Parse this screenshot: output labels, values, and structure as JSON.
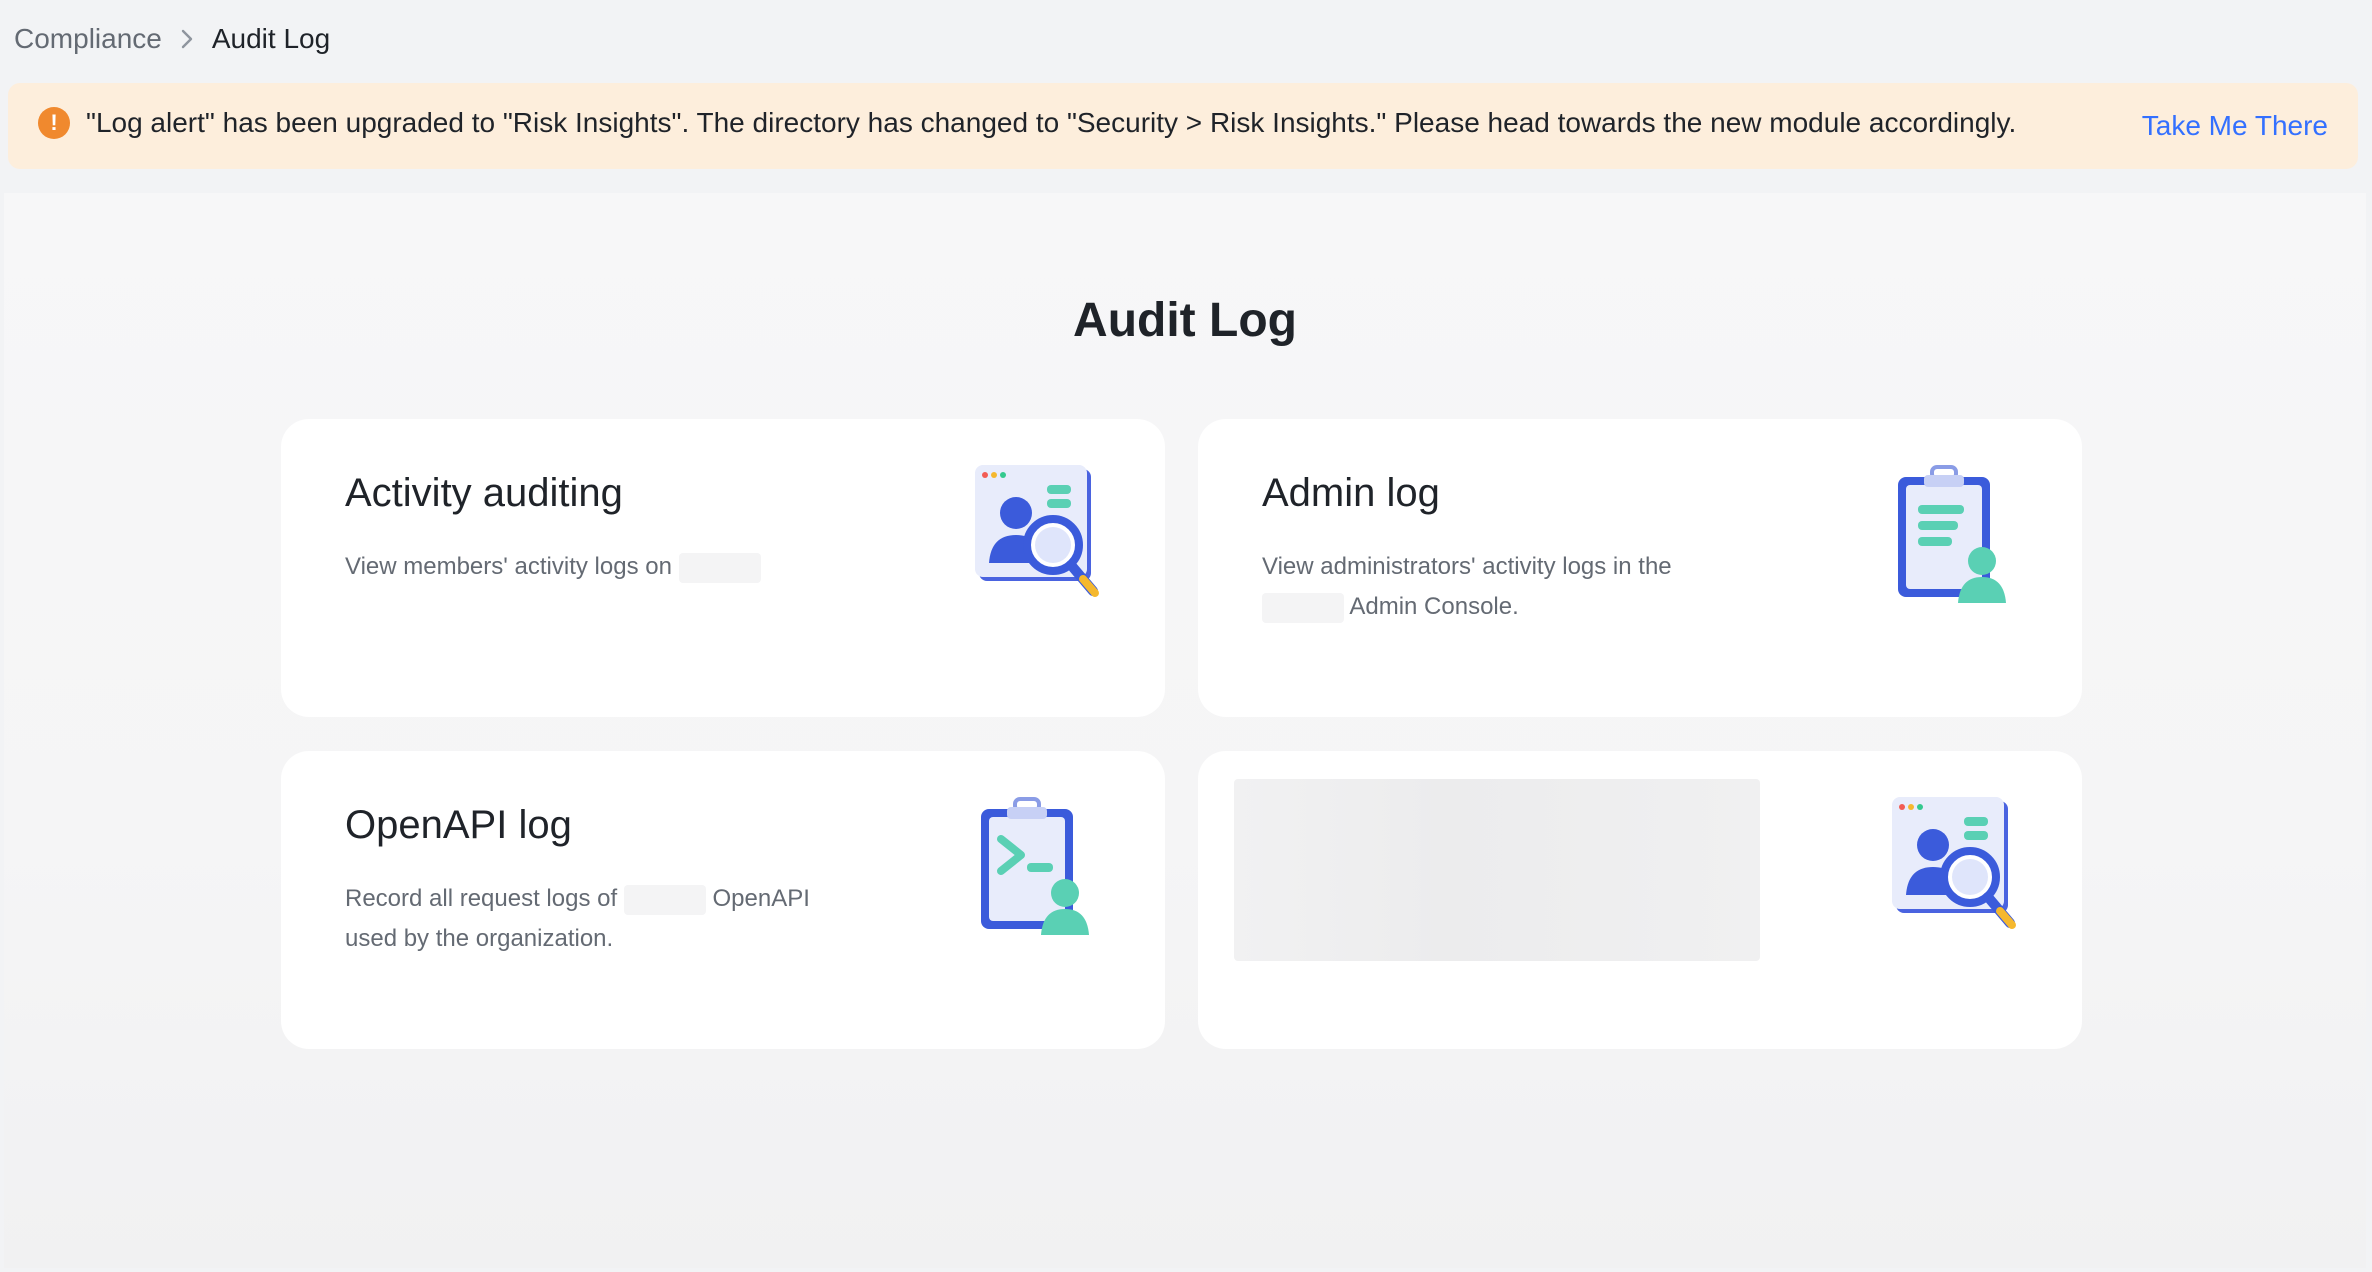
{
  "breadcrumb": {
    "parent": "Compliance",
    "current": "Audit Log"
  },
  "alert": {
    "message": "\"Log alert\" has been upgraded to \"Risk Insights\". The directory has changed to \"Security > Risk Insights.\" Please head towards the new module accordingly.",
    "link_label": "Take Me There",
    "accent_color": "#f0892e",
    "background_color": "#fdeedc",
    "link_color": "#3370ff"
  },
  "main": {
    "title": "Audit Log",
    "cards": [
      {
        "title": "Activity auditing",
        "desc_before": "View members' activity logs on",
        "desc_after": "",
        "icon": "profile-magnifier-icon"
      },
      {
        "title": "Admin log",
        "desc_before": "View administrators' activity logs in the",
        "desc_after": "Admin Console.",
        "icon": "clipboard-user-icon"
      },
      {
        "title": "OpenAPI log",
        "desc_before": "Record all request logs of",
        "desc_after": "OpenAPI used by the organization.",
        "icon": "clipboard-terminal-icon"
      },
      {
        "title": "",
        "desc_before": "",
        "desc_after": "",
        "icon": "profile-magnifier-icon"
      }
    ]
  }
}
